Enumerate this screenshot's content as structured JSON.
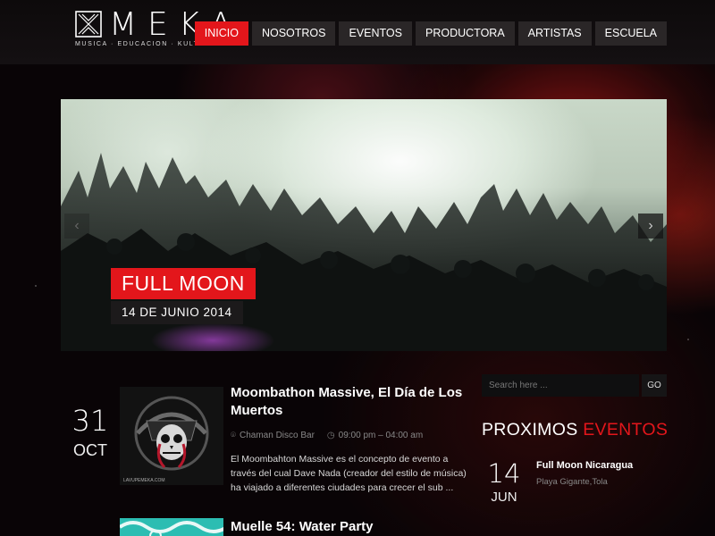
{
  "brand": {
    "name": "MEKA",
    "tagline": "MUSICA · EDUCACION · KULTURA · ARTE",
    "accent_color": "#e3161b"
  },
  "nav": {
    "items": [
      {
        "label": "INICIO",
        "active": true
      },
      {
        "label": "NOSOTROS",
        "active": false
      },
      {
        "label": "EVENTOS",
        "active": false
      },
      {
        "label": "PRODUCTORA",
        "active": false
      },
      {
        "label": "ARTISTAS",
        "active": false
      },
      {
        "label": "ESCUELA",
        "active": false
      }
    ]
  },
  "slider": {
    "title": "FULL MOON",
    "date": "14 DE JUNIO 2014",
    "prev_icon": "chevron-left-icon",
    "next_icon": "chevron-right-icon"
  },
  "events": [
    {
      "day": "31",
      "month": "OCT",
      "title": "Moombathon Massive, El Día de Los Muertos",
      "venue": "Chaman Disco Bar",
      "time": "09:00 pm – 04:00 am",
      "description": "El Moombahton Massive es el concepto de evento a través del cual Dave Nada (creador del estilo de música) ha viajado a diferentes ciudades para crecer el sub ..."
    },
    {
      "title": "Muelle 54: Water Party"
    }
  ],
  "sidebar": {
    "search_placeholder": "Search here ...",
    "search_button": "GO",
    "upcoming_title_white": "PROXIMOS",
    "upcoming_title_red": "EVENTOS",
    "upcoming": [
      {
        "day": "14",
        "month": "JUN",
        "title": "Full Moon Nicaragua",
        "place": "Playa Gigante,Tola"
      }
    ]
  }
}
